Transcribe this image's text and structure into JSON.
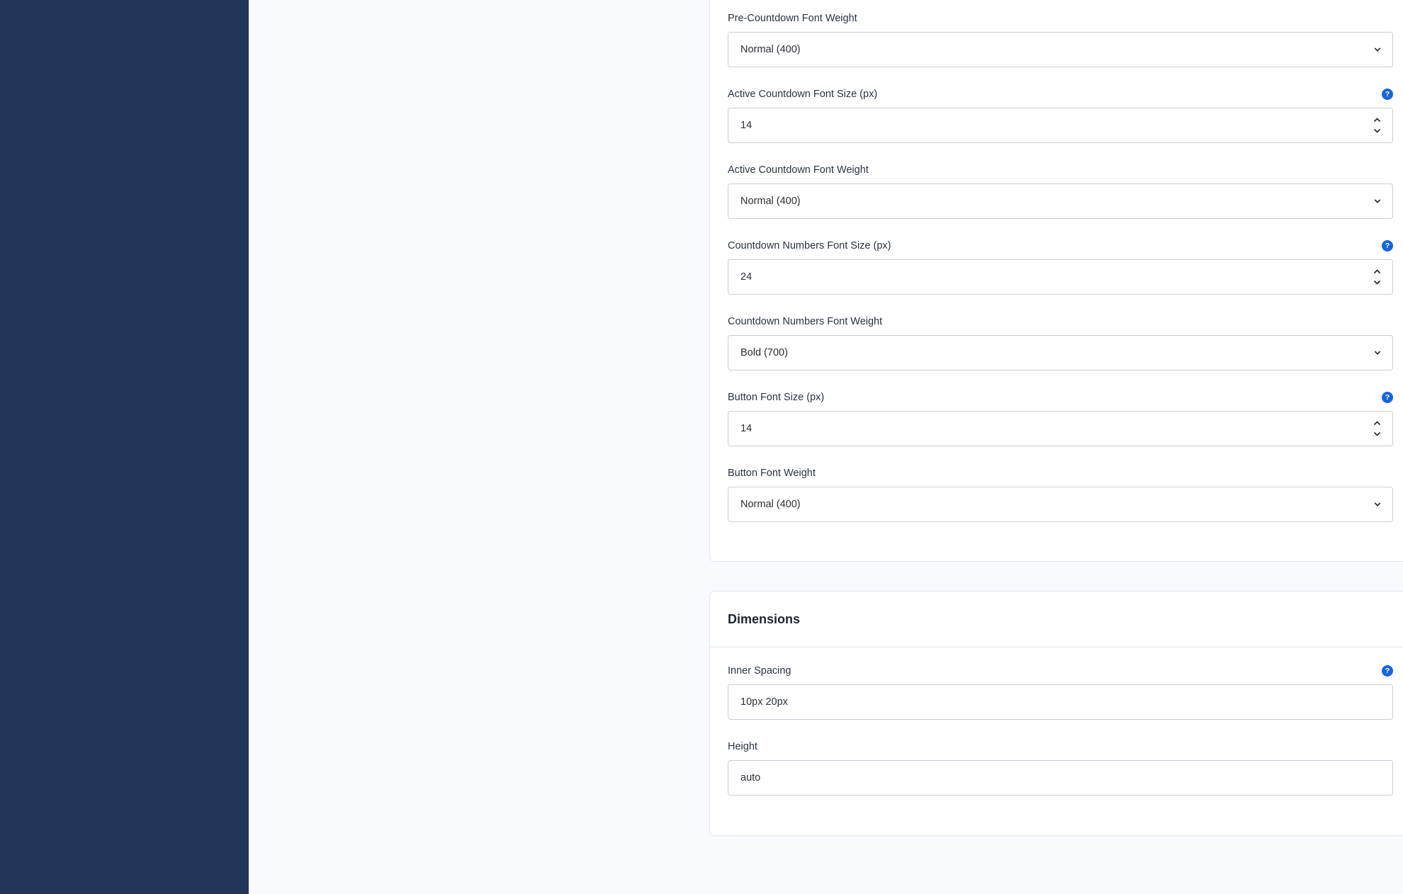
{
  "fields_top": [
    {
      "label": "Pre-Countdown Font Weight",
      "type": "select",
      "value": "Normal (400)",
      "help": false
    },
    {
      "label": "Active Countdown Font Size (px)",
      "type": "number",
      "value": "14",
      "help": true
    },
    {
      "label": "Active Countdown Font Weight",
      "type": "select",
      "value": "Normal (400)",
      "help": false
    },
    {
      "label": "Countdown Numbers Font Size (px)",
      "type": "number",
      "value": "24",
      "help": true
    },
    {
      "label": "Countdown Numbers Font Weight",
      "type": "select",
      "value": "Bold (700)",
      "help": false
    },
    {
      "label": "Button Font Size (px)",
      "type": "number",
      "value": "14",
      "help": true
    },
    {
      "label": "Button Font Weight",
      "type": "select",
      "value": "Normal (400)",
      "help": false
    }
  ],
  "dimensions": {
    "title": "Dimensions",
    "fields": [
      {
        "label": "Inner Spacing",
        "type": "text",
        "value": "10px 20px",
        "help": true
      },
      {
        "label": "Height",
        "type": "text",
        "value": "auto",
        "help": false
      }
    ]
  },
  "help_glyph": "?",
  "icons": {
    "help": "question-circle-icon",
    "select": "chevron-down-icon",
    "spinner": "spinner-arrows-icon"
  },
  "colors": {
    "sidebar": "#233657",
    "accent": "#1565e0",
    "background": "#f8fafd"
  }
}
